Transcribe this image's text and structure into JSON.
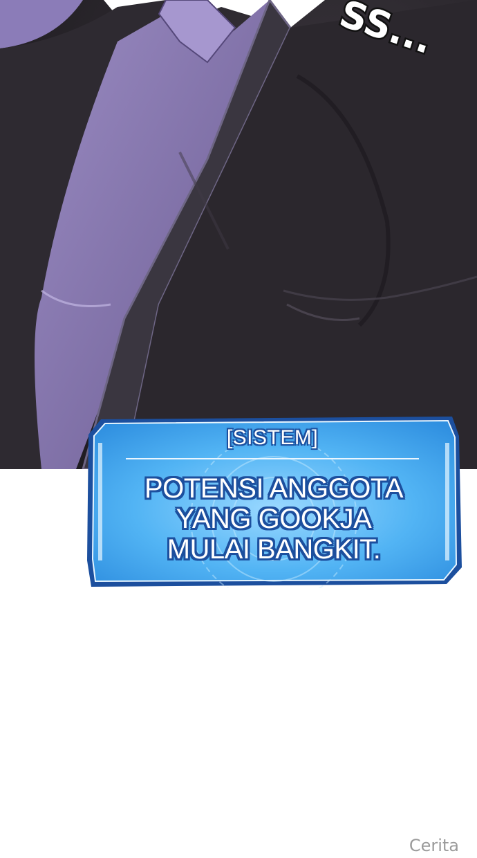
{
  "artwork": {
    "sfx_text": "SS..."
  },
  "system_box": {
    "header": "[SISTEM]",
    "message_lines": [
      "POTENSI ANGGOTA",
      "YANG GOOKJA",
      "MULAI BANGKIT."
    ]
  },
  "corner_label": "Cerita",
  "colors": {
    "box_fill": "#4fb3f5",
    "box_border": "#1c4f9e",
    "jacket": "#2b272d",
    "shirt": "#7f6fa6"
  }
}
